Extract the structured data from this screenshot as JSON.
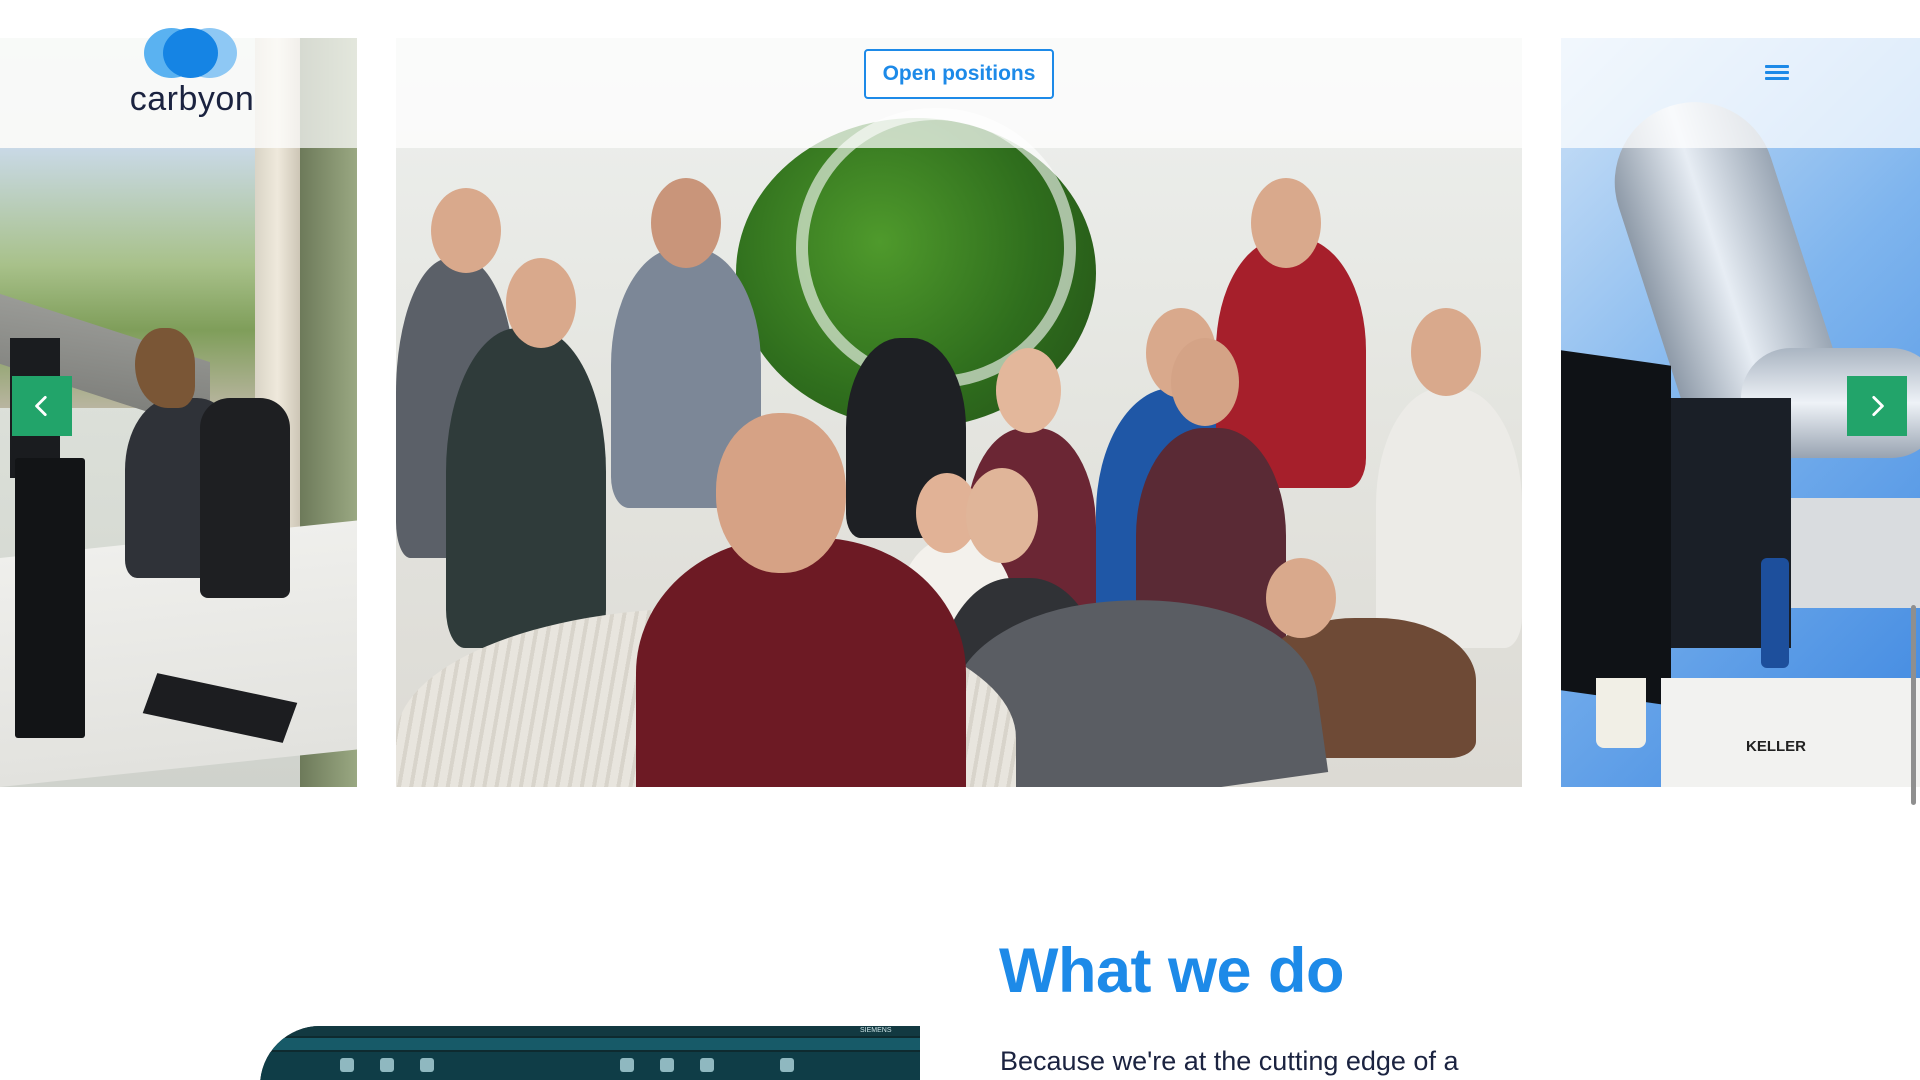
{
  "header": {
    "logo_text": "carbyon",
    "open_positions_label": "Open positions",
    "menu_icon": "hamburger-menu-icon"
  },
  "carousel": {
    "prev_icon": "chevron-left-icon",
    "next_icon": "chevron-right-icon",
    "right_slide_brand": "KELLER"
  },
  "section": {
    "title": "What we do",
    "body": "Because we're at the cutting edge of a"
  },
  "screenshot_thumb": {
    "brand": "SIEMENS"
  },
  "colors": {
    "accent_blue": "#1d8ae8",
    "arrow_green": "#22a46a",
    "text_dark": "#1b2340"
  }
}
